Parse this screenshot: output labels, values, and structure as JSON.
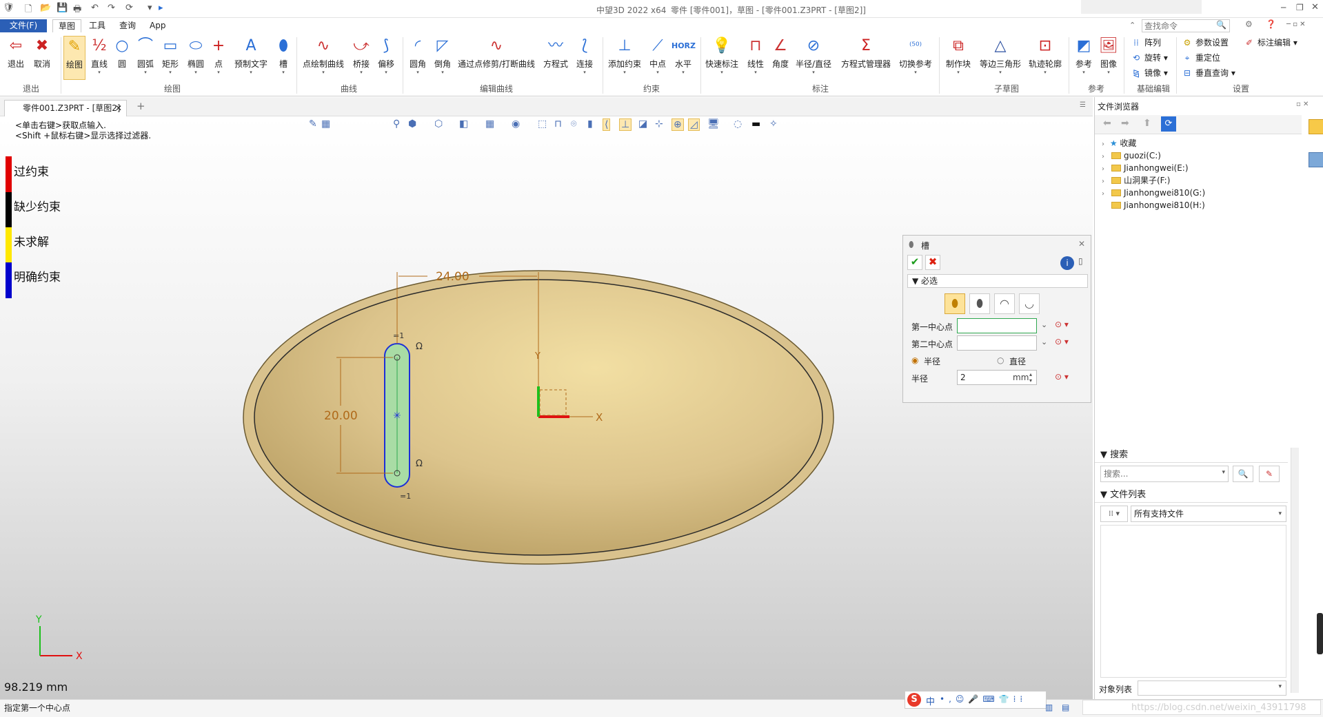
{
  "title": {
    "app": "中望3D 2022 x64",
    "doc": "零件 [零件001]，草图 - [零件001.Z3PRT - [草图2]]",
    "search_placeholder": "查找命令"
  },
  "menu": {
    "file": "文件(F)",
    "items": [
      "草图",
      "工具",
      "查询",
      "App"
    ]
  },
  "ribbon": {
    "groups": [
      "退出",
      "绘图",
      "曲线",
      "编辑曲线",
      "约束",
      "标注",
      "子草图",
      "参考",
      "基础编辑",
      "设置"
    ],
    "buttons": [
      "退出",
      "取消",
      "绘图",
      "直线",
      "圆",
      "圆弧",
      "矩形",
      "椭圆",
      "点",
      "预制文字",
      "槽",
      "点绘制曲线",
      "桥接",
      "偏移",
      "圆角",
      "倒角",
      "通过点修剪/打断曲线",
      "方程式",
      "连接",
      "添加约束",
      "中点",
      "水平",
      "快速标注",
      "线性",
      "角度",
      "半径/直径",
      "方程式管理器",
      "切换参考",
      "制作块",
      "等边三角形",
      "轨迹轮廓",
      "参考",
      "图像"
    ],
    "small": [
      "阵列",
      "旋转",
      "镜像",
      "参数设置",
      "重定位",
      "垂直查询",
      "标注编辑"
    ],
    "horz": "HORZ"
  },
  "tab": {
    "label": "零件001.Z3PRT - [草图2]",
    "add": "+"
  },
  "hints": [
    "<单击右键>获取点输入.",
    "<Shift +鼠标右键>显示选择过滤器."
  ],
  "legend": [
    {
      "label": "过约束",
      "color": "#e00000"
    },
    {
      "label": "缺少约束",
      "color": "#000000"
    },
    {
      "label": "未求解",
      "color": "#ffe800"
    },
    {
      "label": "明确约束",
      "color": "#0000cc"
    }
  ],
  "sketch": {
    "dim_h": "24.00",
    "dim_v": "20.00",
    "axis_x": "X",
    "axis_y": "Y",
    "eq1": "=1",
    "eq2": "=1",
    "omega": "Ω"
  },
  "coord": {
    "x": "X",
    "y": "Y"
  },
  "scale": "98.219 mm",
  "status": "指定第一个中心点",
  "panel": {
    "title": "槽",
    "section": "必选",
    "first_center": "第一中心点",
    "second_center": "第二中心点",
    "radius_opt": "半径",
    "diameter_opt": "直径",
    "radius_label": "半径",
    "radius_value": "2",
    "unit": "mm"
  },
  "browser": {
    "title": "文件浏览器",
    "favorites": "收藏",
    "drives": [
      "guozi(C:)",
      "Jianhongwei(E:)",
      "山洞果子(F:)",
      "Jianhongwei810(G:)",
      "Jianhongwei810(H:)"
    ],
    "search_head": "搜索",
    "search_placeholder": "搜索...",
    "filelist_head": "文件列表",
    "filter": "所有支持文件",
    "object_list": "对象列表"
  },
  "watermark": "https://blog.csdn.net/weixin_43911798",
  "ime": "中"
}
